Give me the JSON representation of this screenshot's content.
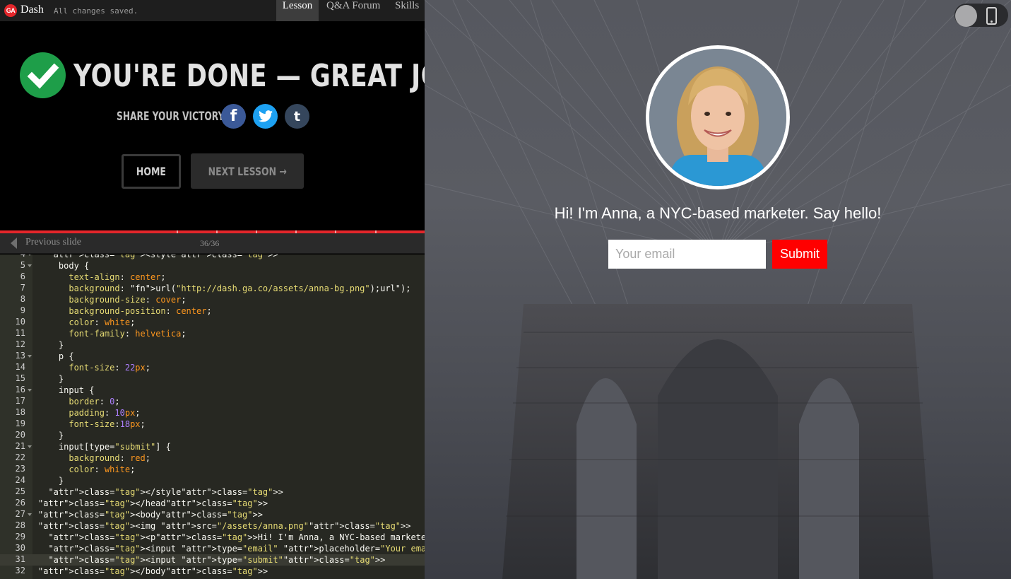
{
  "topbar": {
    "logo": "GA",
    "app_name": "Dash",
    "status": "All changes saved.",
    "tabs": [
      "Lesson",
      "Q&A Forum",
      "Skills"
    ]
  },
  "completion": {
    "title": "YOU'RE DONE — GREAT JOB!",
    "share_label": "SHARE YOUR VICTORY:",
    "home_label": "HOME",
    "next_label": "NEXT LESSON →"
  },
  "slides": {
    "prev_label": "Previous slide",
    "counter": "36/36"
  },
  "editor": {
    "lines": [
      {
        "n": "4",
        "fold": true
      },
      {
        "n": "5",
        "fold": true
      },
      {
        "n": "6",
        "fold": false
      },
      {
        "n": "7",
        "fold": false
      },
      {
        "n": "8",
        "fold": false
      },
      {
        "n": "9",
        "fold": false
      },
      {
        "n": "10",
        "fold": false
      },
      {
        "n": "11",
        "fold": false
      },
      {
        "n": "12",
        "fold": false
      },
      {
        "n": "13",
        "fold": true
      },
      {
        "n": "14",
        "fold": false
      },
      {
        "n": "15",
        "fold": false
      },
      {
        "n": "16",
        "fold": true
      },
      {
        "n": "17",
        "fold": false
      },
      {
        "n": "18",
        "fold": false
      },
      {
        "n": "19",
        "fold": false
      },
      {
        "n": "20",
        "fold": false
      },
      {
        "n": "21",
        "fold": true
      },
      {
        "n": "22",
        "fold": false
      },
      {
        "n": "23",
        "fold": false
      },
      {
        "n": "24",
        "fold": false
      },
      {
        "n": "25",
        "fold": false
      },
      {
        "n": "26",
        "fold": false
      },
      {
        "n": "27",
        "fold": true
      },
      {
        "n": "28",
        "fold": false
      },
      {
        "n": "29",
        "fold": false
      },
      {
        "n": "30",
        "fold": false
      },
      {
        "n": "31",
        "fold": false
      },
      {
        "n": "32",
        "fold": false
      }
    ],
    "code": [
      "  <style>",
      "    body {",
      "      text-align: center;",
      "      background: url(\"http://dash.ga.co/assets/anna-bg.png\");url\");",
      "      background-size: cover;",
      "      background-position: center;",
      "      color: white;",
      "      font-family: helvetica;",
      "    }",
      "    p {",
      "      font-size: 22px;",
      "    }",
      "    input {",
      "      border: 0;",
      "      padding: 10px;",
      "      font-size:18px;",
      "    }",
      "    input[type=\"submit\"] {",
      "      background: red;",
      "      color: white;",
      "    }",
      "  </style>",
      "</head>",
      "<body>",
      "<img src=\"/assets/anna.png\">",
      "  <p>Hi! I'm Anna, a NYC-based marketer. Say hello!</p>",
      "  <input type=\"email\" placeholder=\"Your email\">",
      "  <input type=\"submit\">",
      "</body>"
    ],
    "highlight_line": "31"
  },
  "preview": {
    "greeting": "Hi! I'm Anna, a NYC-based marketer. Say hello!",
    "email_placeholder": "Your email",
    "submit_label": "Submit"
  },
  "icons": {
    "check": "check-circle-icon",
    "facebook": "facebook-icon",
    "twitter": "twitter-icon",
    "tumblr": "tumblr-icon",
    "phone": "phone-icon"
  },
  "colors": {
    "ga_red": "#e4262b",
    "check_green": "#1e9e49",
    "facebook": "#3b5998",
    "twitter": "#1da1f2",
    "tumblr": "#35465c",
    "submit_red": "#ff0000"
  }
}
